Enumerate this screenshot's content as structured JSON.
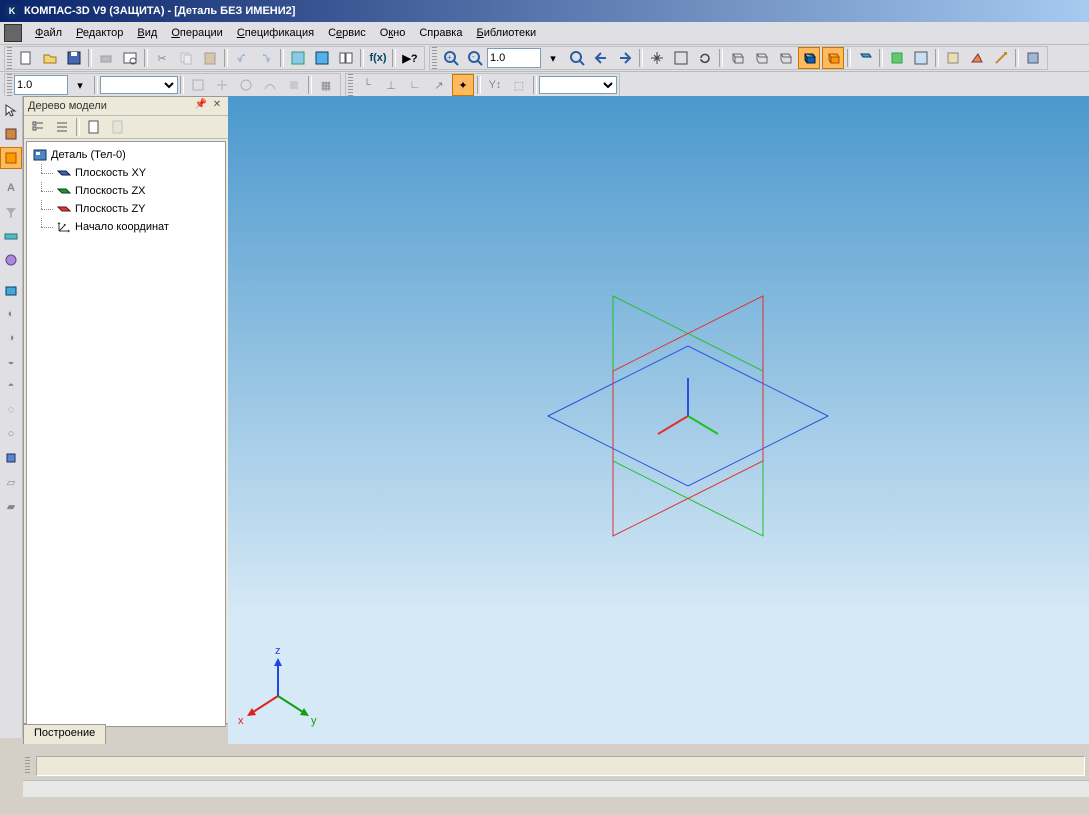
{
  "title": "КОМПАС-3D V9 (ЗАЩИТА) - [Деталь БЕЗ ИМЕНИ2]",
  "menu": {
    "file": "Файл",
    "editor": "Редактор",
    "view": "Вид",
    "operations": "Операции",
    "specification": "Спецификация",
    "service": "Сервис",
    "window": "Окно",
    "help": "Справка",
    "libraries": "Библиотеки"
  },
  "panel": {
    "title": "Дерево модели"
  },
  "tree": {
    "root": "Деталь (Тел-0)",
    "items": [
      {
        "label": "Плоскость XY",
        "color": "#2a4fd0"
      },
      {
        "label": "Плоскость ZX",
        "color": "#2a8a2a"
      },
      {
        "label": "Плоскость ZY",
        "color": "#c83232"
      },
      {
        "label": "Начало координат",
        "color": "#333"
      }
    ]
  },
  "bottomTab": "Построение",
  "combo": {
    "scale1": "1.0",
    "scale2": "1.0",
    "variant": ""
  },
  "axes": {
    "x": "x",
    "y": "y",
    "z": "z"
  }
}
